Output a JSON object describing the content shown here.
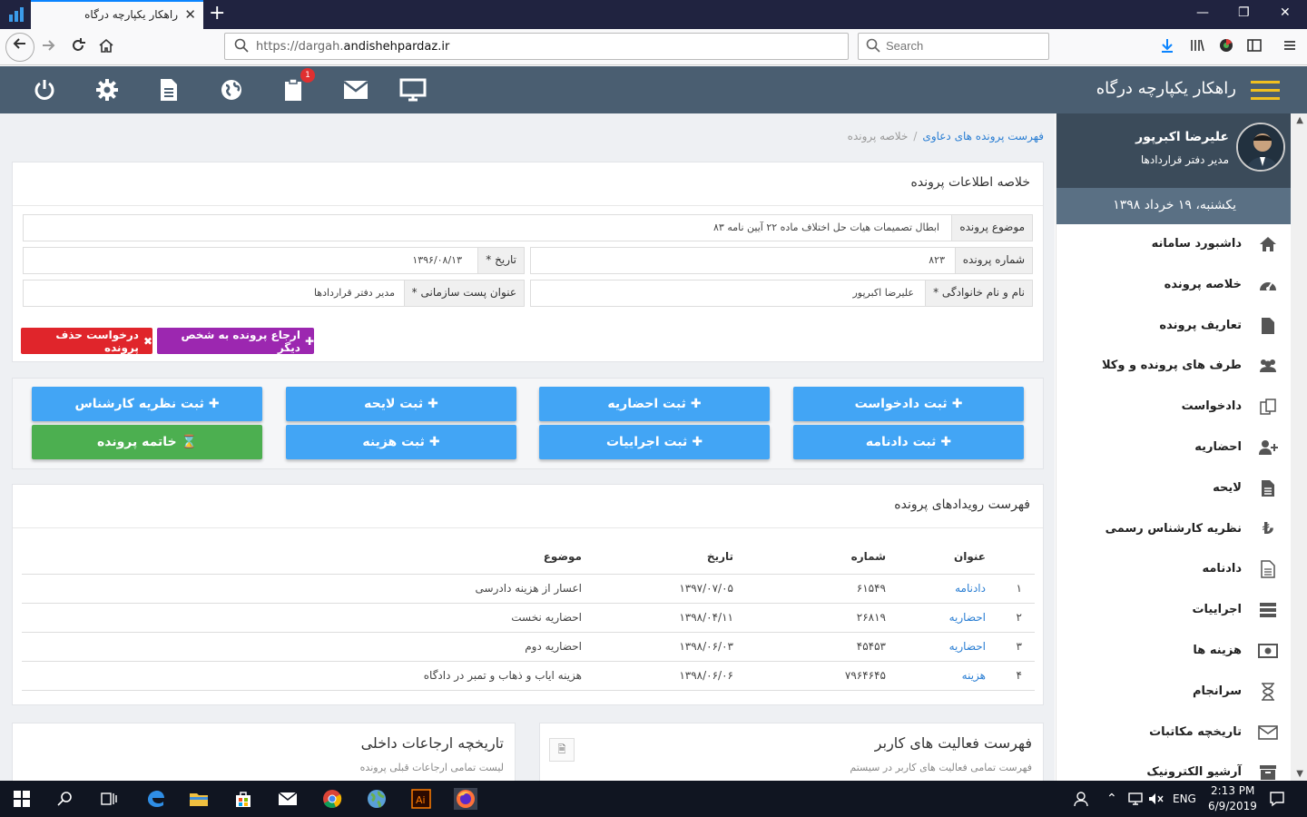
{
  "browser": {
    "tab_title": "راهکار یکپارچه درگاه",
    "url_prefix": "https://dargah.",
    "url_domain": "andishehpardaz.ir",
    "search_placeholder": "Search"
  },
  "header": {
    "brand": "راهکار یکپارچه درگاه",
    "notification_count": "1"
  },
  "sidebar": {
    "user_name": "علیرضا اکبرپور",
    "user_role": "مدیر دفتر قراردادها",
    "date": "یکشنبه، ۱۹ خرداد ۱۳۹۸",
    "items": [
      {
        "label": "داشبورد سامانه",
        "icon": "home-icon"
      },
      {
        "label": "خلاصه پرونده",
        "icon": "dashboard-icon"
      },
      {
        "label": "تعاریف پرونده",
        "icon": "file-icon"
      },
      {
        "label": "طرف های پرونده و وکلا",
        "icon": "users-icon"
      },
      {
        "label": "دادخواست",
        "icon": "copy-icon"
      },
      {
        "label": "احضاریه",
        "icon": "user-plus-icon"
      },
      {
        "label": "لایحه",
        "icon": "file-text-icon"
      },
      {
        "label": "نظریه کارشناس رسمی",
        "icon": "turkish-lira-icon"
      },
      {
        "label": "دادنامه",
        "icon": "file-outline-icon"
      },
      {
        "label": "اجراییات",
        "icon": "server-icon"
      },
      {
        "label": "هزینه ها",
        "icon": "money-icon"
      },
      {
        "label": "سرانجام",
        "icon": "hourglass-icon"
      },
      {
        "label": "تاریخچه مکاتبات",
        "icon": "envelope-icon"
      },
      {
        "label": "آرشیو الکترونیک",
        "icon": "archive-icon"
      }
    ]
  },
  "breadcrumb": {
    "parent": "فهرست پرونده های دعاوی",
    "current": "خلاصه پرونده"
  },
  "summary": {
    "title": "خلاصه اطلاعات پرونده",
    "subject_label": "موضوع پرونده",
    "subject_value": "ابطال تصمیمات هیات حل اختلاف ماده ۲۲ آیین نامه ۸۳",
    "case_no_label": "شماره پرونده",
    "case_no_value": "۸۲۳",
    "date_label": "تاریخ *",
    "date_value": "۱۳۹۶/۰۸/۱۳",
    "name_label": "نام و نام خانوادگی *",
    "name_value": "علیرضا اکبرپور",
    "position_label": "عنوان پست سازمانی *",
    "position_value": "مدیر دفتر قراردادها",
    "refer_button": "ارجاع پرونده به شخص دیگر",
    "delete_button": "درخواست حذف پرونده"
  },
  "actions": {
    "petition": "ثبت دادخواست",
    "summons": "ثبت احضاریه",
    "brief": "ثبت لایحه",
    "expert": "ثبت نظریه کارشناس",
    "verdict": "ثبت دادنامه",
    "execution": "ثبت اجراییات",
    "cost": "ثبت هزینه",
    "close": "خاتمه پرونده"
  },
  "events": {
    "title": "فهرست رویدادهای پرونده",
    "columns": [
      "عنوان",
      "شماره",
      "تاریخ",
      "موضوع"
    ],
    "rows": [
      {
        "idx": "۱",
        "title": "دادنامه",
        "number": "۶۱۵۴۹",
        "date": "۱۳۹۷/۰۷/۰۵",
        "subject": "اعسار از هزینه دادرسی"
      },
      {
        "idx": "۲",
        "title": "احضاریه",
        "number": "۲۶۸۱۹",
        "date": "۱۳۹۸/۰۴/۱۱",
        "subject": "احضاریه نخست"
      },
      {
        "idx": "۳",
        "title": "احضاریه",
        "number": "۴۵۴۵۳",
        "date": "۱۳۹۸/۰۶/۰۳",
        "subject": "احضاریه دوم"
      },
      {
        "idx": "۴",
        "title": "هزینه",
        "number": "۷۹۶۴۶۴۵",
        "date": "۱۳۹۸/۰۶/۰۶",
        "subject": "هزینه ایاب و ذهاب و تمبر در دادگاه"
      }
    ]
  },
  "activity": {
    "title": "فهرست فعالیت های کاربر",
    "subtitle": "فهرست تمامی فعالیت های کاربر در سیستم"
  },
  "referrals": {
    "title": "تاریخچه ارجاعات داخلی",
    "subtitle": "لیست تمامی ارجاعات قبلی پرونده"
  },
  "taskbar": {
    "lang": "ENG",
    "time": "2:13 PM",
    "date": "6/9/2019"
  }
}
